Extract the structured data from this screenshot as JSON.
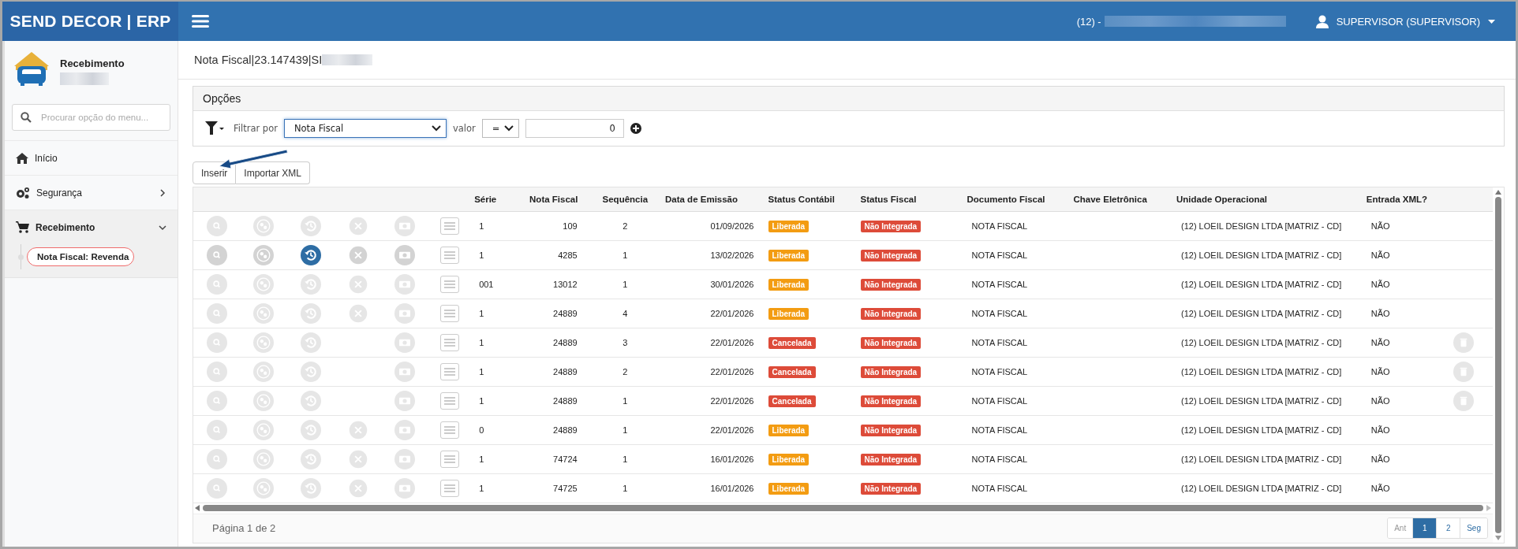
{
  "header": {
    "brand": "SEND DECOR | ERP",
    "company": "(12) -",
    "user": "SUPERVISOR (SUPERVISOR)"
  },
  "sidebar": {
    "module": "Recebimento",
    "search": {
      "placeholder": "Procurar opção do menu..."
    },
    "items": [
      {
        "label": "Início",
        "kind": "link",
        "expanded": false
      },
      {
        "label": "Segurança",
        "kind": "group",
        "expanded": false
      },
      {
        "label": "Recebimento",
        "kind": "group",
        "expanded": true,
        "children": [
          {
            "label": "Nota Fiscal: Revenda",
            "selected": true
          }
        ]
      }
    ]
  },
  "page_title": "Nota Fiscal|23.147439|SI",
  "options": {
    "title": "Opções",
    "filter_label": "Filtrar por",
    "field": "Nota Fiscal",
    "value_label": "valor",
    "operator": "=",
    "value": "0"
  },
  "buttons": [
    "Inserir",
    "Importar XML"
  ],
  "table": {
    "columns": [
      "Série",
      "Nota Fiscal",
      "Sequência",
      "Data de Emissão",
      "Status Contábil",
      "Status Fiscal",
      "Documento Fiscal",
      "Chave Eletrônica",
      "Unidade Operacional",
      "Entrada XML?"
    ],
    "rows": [
      {
        "serie": "1",
        "nota": "109",
        "sequencia": "2",
        "data": "01/09/2026",
        "status_contabil": {
          "label": "Liberada",
          "color": "#f39c12"
        },
        "status_fiscal": {
          "label": "Não Integrada",
          "color": "#dd4b39"
        },
        "documento": "NOTA FISCAL",
        "unidade": "(12) LOEIL DESIGN LTDA [MATRIZ - CD]",
        "entrada_xml": "NÃO",
        "active": false,
        "can_cancel": true,
        "can_delete": false
      },
      {
        "serie": "1",
        "nota": "4285",
        "sequencia": "1",
        "data": "13/02/2026",
        "status_contabil": {
          "label": "Liberada",
          "color": "#f39c12"
        },
        "status_fiscal": {
          "label": "Não Integrada",
          "color": "#dd4b39"
        },
        "documento": "NOTA FISCAL",
        "unidade": "(12) LOEIL DESIGN LTDA [MATRIZ - CD]",
        "entrada_xml": "NÃO",
        "active": true,
        "can_cancel": true,
        "can_delete": false
      },
      {
        "serie": "001",
        "nota": "13012",
        "sequencia": "1",
        "data": "30/01/2026",
        "status_contabil": {
          "label": "Liberada",
          "color": "#f39c12"
        },
        "status_fiscal": {
          "label": "Não Integrada",
          "color": "#dd4b39"
        },
        "documento": "NOTA FISCAL",
        "unidade": "(12) LOEIL DESIGN LTDA [MATRIZ - CD]",
        "entrada_xml": "NÃO",
        "active": false,
        "can_cancel": true,
        "can_delete": false
      },
      {
        "serie": "1",
        "nota": "24889",
        "sequencia": "4",
        "data": "22/01/2026",
        "status_contabil": {
          "label": "Liberada",
          "color": "#f39c12"
        },
        "status_fiscal": {
          "label": "Não Integrada",
          "color": "#dd4b39"
        },
        "documento": "NOTA FISCAL",
        "unidade": "(12) LOEIL DESIGN LTDA [MATRIZ - CD]",
        "entrada_xml": "NÃO",
        "active": false,
        "can_cancel": true,
        "can_delete": false
      },
      {
        "serie": "1",
        "nota": "24889",
        "sequencia": "3",
        "data": "22/01/2026",
        "status_contabil": {
          "label": "Cancelada",
          "color": "#dd4b39"
        },
        "status_fiscal": {
          "label": "Não Integrada",
          "color": "#dd4b39"
        },
        "documento": "NOTA FISCAL",
        "unidade": "(12) LOEIL DESIGN LTDA [MATRIZ - CD]",
        "entrada_xml": "NÃO",
        "active": false,
        "can_cancel": false,
        "can_delete": true
      },
      {
        "serie": "1",
        "nota": "24889",
        "sequencia": "2",
        "data": "22/01/2026",
        "status_contabil": {
          "label": "Cancelada",
          "color": "#dd4b39"
        },
        "status_fiscal": {
          "label": "Não Integrada",
          "color": "#dd4b39"
        },
        "documento": "NOTA FISCAL",
        "unidade": "(12) LOEIL DESIGN LTDA [MATRIZ - CD]",
        "entrada_xml": "NÃO",
        "active": false,
        "can_cancel": false,
        "can_delete": true
      },
      {
        "serie": "1",
        "nota": "24889",
        "sequencia": "1",
        "data": "22/01/2026",
        "status_contabil": {
          "label": "Cancelada",
          "color": "#dd4b39"
        },
        "status_fiscal": {
          "label": "Não Integrada",
          "color": "#dd4b39"
        },
        "documento": "NOTA FISCAL",
        "unidade": "(12) LOEIL DESIGN LTDA [MATRIZ - CD]",
        "entrada_xml": "NÃO",
        "active": false,
        "can_cancel": false,
        "can_delete": true
      },
      {
        "serie": "0",
        "nota": "24889",
        "sequencia": "1",
        "data": "22/01/2026",
        "status_contabil": {
          "label": "Liberada",
          "color": "#f39c12"
        },
        "status_fiscal": {
          "label": "Não Integrada",
          "color": "#dd4b39"
        },
        "documento": "NOTA FISCAL",
        "unidade": "(12) LOEIL DESIGN LTDA [MATRIZ - CD]",
        "entrada_xml": "NÃO",
        "active": false,
        "can_cancel": true,
        "can_delete": false
      },
      {
        "serie": "1",
        "nota": "74724",
        "sequencia": "1",
        "data": "16/01/2026",
        "status_contabil": {
          "label": "Liberada",
          "color": "#f39c12"
        },
        "status_fiscal": {
          "label": "Não Integrada",
          "color": "#dd4b39"
        },
        "documento": "NOTA FISCAL",
        "unidade": "(12) LOEIL DESIGN LTDA [MATRIZ - CD]",
        "entrada_xml": "NÃO",
        "active": false,
        "can_cancel": true,
        "can_delete": false
      },
      {
        "serie": "1",
        "nota": "74725",
        "sequencia": "1",
        "data": "16/01/2026",
        "status_contabil": {
          "label": "Liberada",
          "color": "#f39c12"
        },
        "status_fiscal": {
          "label": "Não Integrada",
          "color": "#dd4b39"
        },
        "documento": "NOTA FISCAL",
        "unidade": "(12) LOEIL DESIGN LTDA [MATRIZ - CD]",
        "entrada_xml": "NÃO",
        "active": false,
        "can_cancel": true,
        "can_delete": false
      }
    ]
  },
  "pagination": {
    "summary": "Página 1 de 2",
    "pages": [
      {
        "label": "Ant",
        "selected": false,
        "disabled": true
      },
      {
        "label": "1",
        "selected": true,
        "disabled": false
      },
      {
        "label": "2",
        "selected": false,
        "disabled": false
      },
      {
        "label": "Seg",
        "selected": false,
        "disabled": false
      }
    ]
  }
}
